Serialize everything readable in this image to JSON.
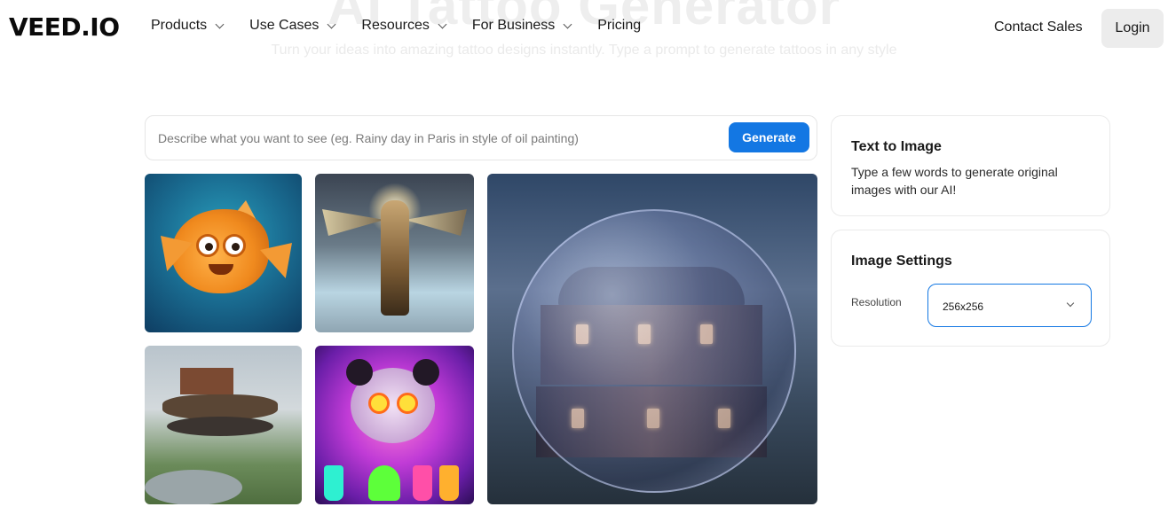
{
  "hero": {
    "title": "AI Tattoo Generator",
    "subtitle": "Turn your ideas into amazing tattoo designs instantly. Type a prompt to generate tattoos in any style"
  },
  "nav": {
    "logo": "VEED.IO",
    "items": [
      {
        "label": "Products",
        "has_dropdown": true
      },
      {
        "label": "Use Cases",
        "has_dropdown": true
      },
      {
        "label": "Resources",
        "has_dropdown": true
      },
      {
        "label": "For Business",
        "has_dropdown": true
      },
      {
        "label": "Pricing",
        "has_dropdown": false
      }
    ],
    "contact_sales": "Contact Sales",
    "login": "Login"
  },
  "prompt": {
    "placeholder": "Describe what you want to see (eg. Rainy day in Paris in style of oil painting)",
    "value": "",
    "generate_label": "Generate"
  },
  "gallery": {
    "images": [
      {
        "name": "cartoon-fish-image"
      },
      {
        "name": "winged-warrior-image"
      },
      {
        "name": "flying-house-image"
      },
      {
        "name": "scientist-panda-image"
      },
      {
        "name": "bubble-house-image"
      }
    ]
  },
  "text_to_image": {
    "title": "Text to Image",
    "description": "Type a few words to generate original images with our AI!"
  },
  "image_settings": {
    "title": "Image Settings",
    "resolution_label": "Resolution",
    "resolution_value": "256x256"
  },
  "colors": {
    "accent": "#1377e3",
    "login_bg": "#ececec"
  }
}
